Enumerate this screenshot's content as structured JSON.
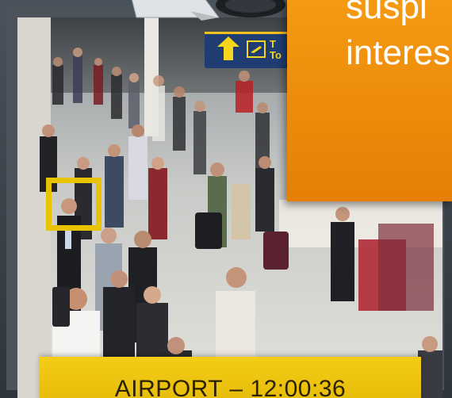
{
  "scene": {
    "description_icon": "airport-crowd-photo",
    "signage": {
      "arrow_icon": "arrow-up-icon",
      "plane_icon": "airplane-icon",
      "text_fragment": "T\nTo"
    }
  },
  "callout": {
    "text": "suspi\ninteres",
    "color": "#f39010"
  },
  "highlight": {
    "color": "#e7c300"
  },
  "caption": {
    "text": "AIRPORT – 12:00:36",
    "color": "#f2c812"
  }
}
